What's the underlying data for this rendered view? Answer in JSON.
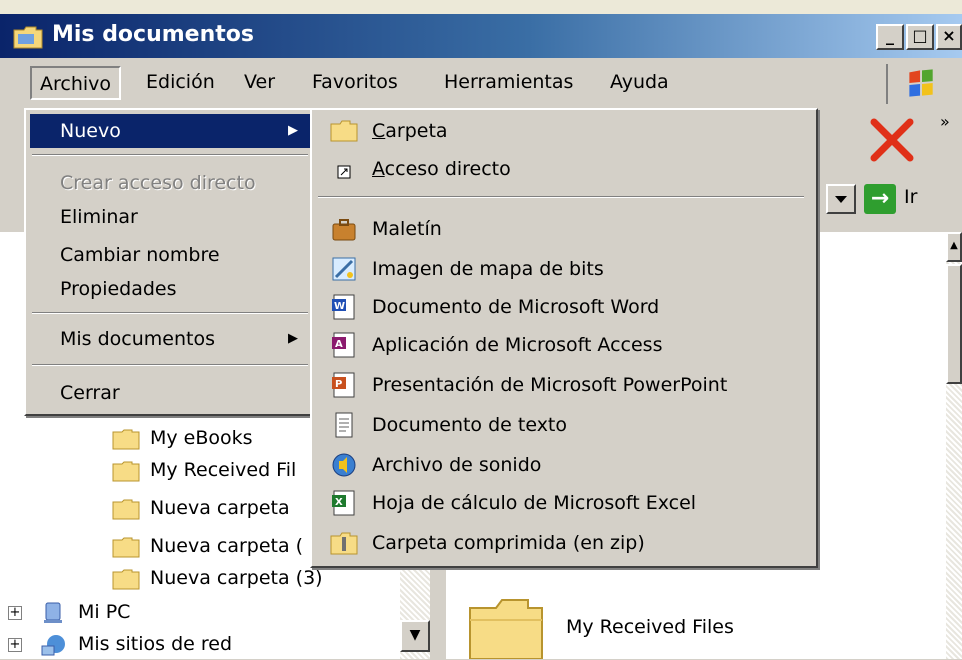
{
  "window": {
    "title": "Mis documentos"
  },
  "menubar": {
    "items": [
      "Archivo",
      "Edición",
      "Ver",
      "Favoritos",
      "Herramientas",
      "Ayuda"
    ]
  },
  "file_menu": {
    "items": [
      {
        "label": "Nuevo",
        "state": "selected",
        "submenu": true
      },
      {
        "label": "Crear acceso directo",
        "state": "disabled"
      },
      {
        "label": "Eliminar"
      },
      {
        "label": "Cambiar nombre"
      },
      {
        "label": "Propiedades"
      },
      {
        "label": "Mis documentos",
        "submenu": true
      },
      {
        "label": "Cerrar"
      }
    ]
  },
  "new_menu": {
    "carpeta_first": "C",
    "carpeta_rest": "arpeta",
    "acceso_first": "A",
    "acceso_rest": "cceso directo",
    "items": [
      {
        "label": "Maletín",
        "icon": "briefcase-icon"
      },
      {
        "label": "Imagen de mapa de bits",
        "icon": "bitmap-icon"
      },
      {
        "label": "Documento de Microsoft Word",
        "icon": "word-icon"
      },
      {
        "label": "Aplicación de Microsoft Access",
        "icon": "access-icon"
      },
      {
        "label": "Presentación de Microsoft PowerPoint",
        "icon": "powerpoint-icon"
      },
      {
        "label": "Documento de texto",
        "icon": "text-document-icon"
      },
      {
        "label": "Archivo de sonido",
        "icon": "sound-file-icon"
      },
      {
        "label": "Hoja de cálculo de Microsoft Excel",
        "icon": "excel-icon"
      },
      {
        "label": "Carpeta comprimida (en zip)",
        "icon": "zip-folder-icon"
      }
    ]
  },
  "address": {
    "go_label": "Ir"
  },
  "folder_tree": {
    "items": [
      {
        "label": "My eBooks"
      },
      {
        "label": "My Received Fil"
      },
      {
        "label": "Nueva carpeta"
      },
      {
        "label": "Nueva carpeta ("
      },
      {
        "label": "Nueva carpeta (3)"
      },
      {
        "label": "Mi PC"
      },
      {
        "label": "Mis sitios de red"
      }
    ]
  },
  "content": {
    "folder_label": "My Received Files"
  },
  "colors": {
    "selection": "#0a246a",
    "face": "#d4d0c8"
  }
}
